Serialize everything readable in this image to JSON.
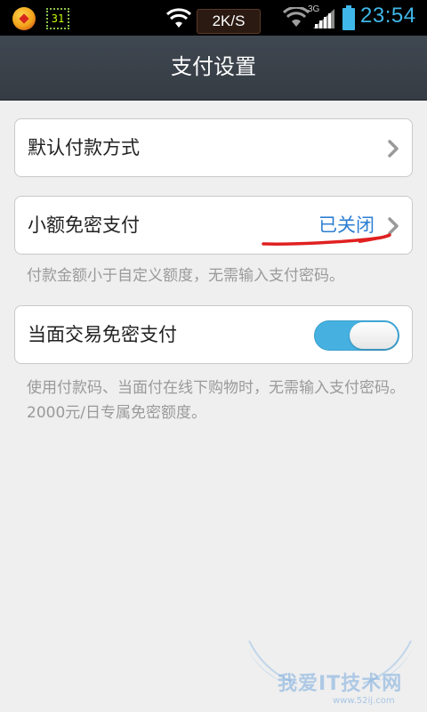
{
  "status_bar": {
    "calendar_day": "31",
    "net_speed": "2K/S",
    "network_type": "3G",
    "time": "23:54",
    "app_icon": "app-notification-icon",
    "wifi_icon": "wifi-icon",
    "signal_icon": "signal-icon",
    "battery_icon": "battery-icon"
  },
  "header": {
    "title": "支付设置"
  },
  "settings": {
    "default_payment": {
      "label": "默认付款方式",
      "icon": "chevron-right-icon"
    },
    "small_amount": {
      "label": "小额免密支付",
      "status": "已关闭",
      "hint": "付款金额小于自定义额度，无需输入支付密码。",
      "icon": "chevron-right-icon"
    },
    "face_to_face": {
      "label": "当面交易免密支付",
      "toggle_on": true,
      "hint": "使用付款码、当面付在线下购物时，无需输入支付密码。2000元/日专属免密额度。"
    }
  },
  "watermark": {
    "text": "我爱IT技术网",
    "url": "www.52ij.com"
  },
  "colors": {
    "status_value": "#2d7fd3",
    "toggle_on": "#46b1e1",
    "header_bg": "#3b434b",
    "annotation_red": "#e02020"
  }
}
